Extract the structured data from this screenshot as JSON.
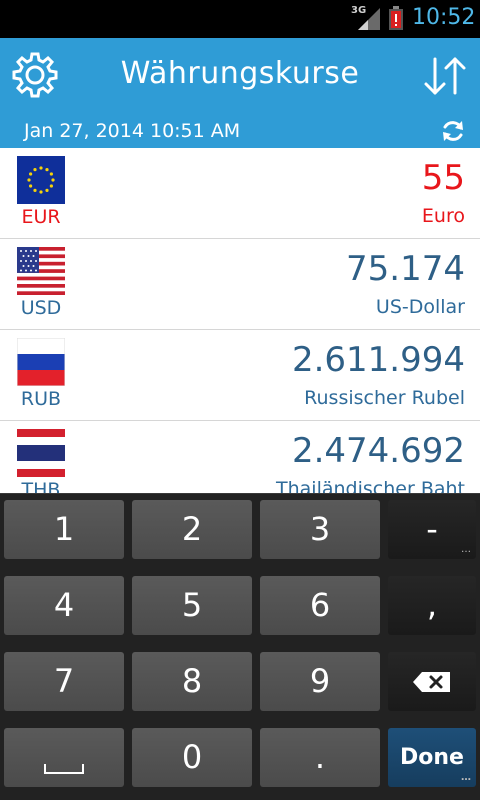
{
  "status_bar": {
    "network": "3G",
    "time": "10:52"
  },
  "header": {
    "title": "Währungskurse",
    "date": "Jan 27, 2014 10:51 AM",
    "icons": {
      "settings": "gear-icon",
      "swap": "swap-arrows-icon",
      "refresh": "refresh-icon"
    }
  },
  "currencies": [
    {
      "code": "EUR",
      "amount": "55",
      "name": "Euro",
      "active": true
    },
    {
      "code": "USD",
      "amount": "75.174",
      "name": "US-Dollar",
      "active": false
    },
    {
      "code": "RUB",
      "amount": "2.611.994",
      "name": "Russischer Rubel",
      "active": false
    },
    {
      "code": "THB",
      "amount": "2.474.692",
      "name": "Thailändischer Baht",
      "active": false
    }
  ],
  "keyboard": {
    "rows": [
      [
        "1",
        "2",
        "3",
        "-"
      ],
      [
        "4",
        "5",
        "6",
        ","
      ],
      [
        "7",
        "8",
        "9",
        "backspace"
      ],
      [
        "space",
        "0",
        ".",
        "Done"
      ]
    ],
    "done_label": "Done"
  },
  "colors": {
    "header": "#2f9cd6",
    "active": "#e8161b",
    "text": "#2e5f86",
    "clock": "#4fb8e8"
  }
}
